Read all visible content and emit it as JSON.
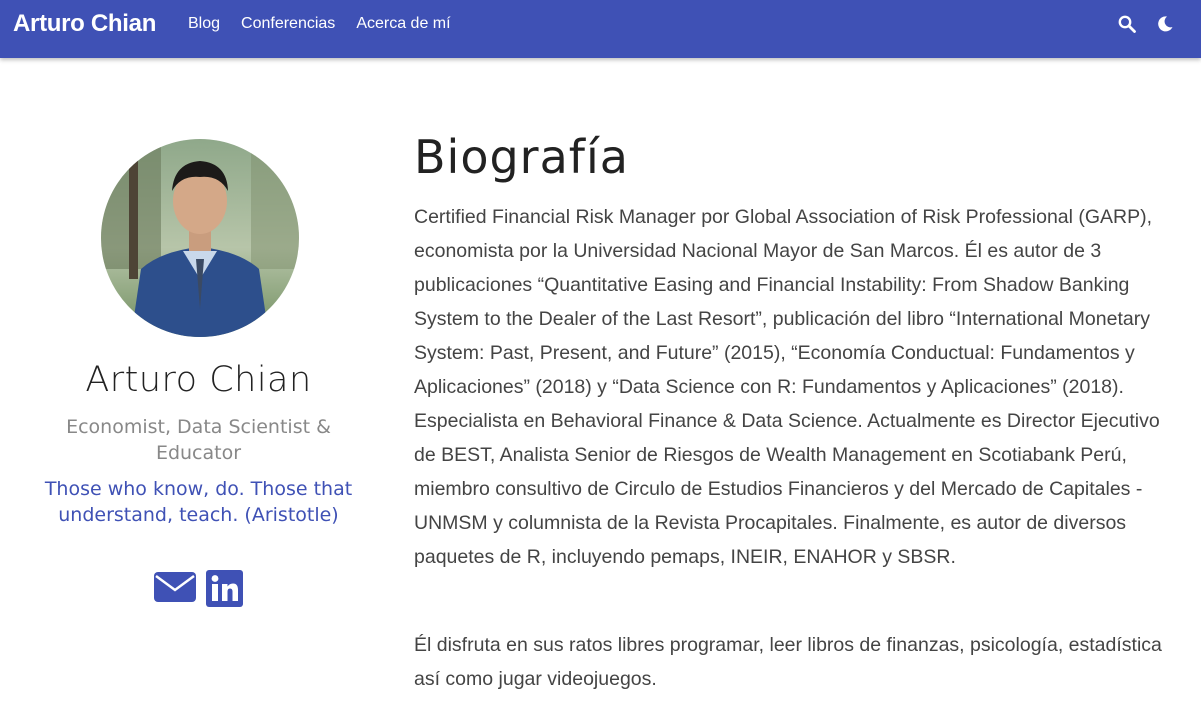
{
  "navbar": {
    "brand": "Arturo Chian",
    "links": [
      "Blog",
      "Conferencias",
      "Acerca de mí"
    ],
    "icons": [
      "search-icon",
      "moon-icon"
    ],
    "background": "#3f51b5"
  },
  "profile": {
    "name": "Arturo Chian",
    "role": "Economist, Data Scientist & Educator",
    "quote": "Those who know, do. Those that understand, teach. (Aristotle)",
    "social_icons": [
      "envelope-icon",
      "linkedin-icon"
    ],
    "accent": "#3f51b5"
  },
  "biography": {
    "title": "Biografía",
    "paragraph1": "Certified Financial Risk Manager por Global Association of Risk Professional (GARP), economista por la Universidad Nacional Mayor de San Marcos. Él es autor de 3 publicaciones “Quantitative Easing and Financial Instability: From Shadow Banking System to the Dealer of the Last Resort”, publicación del libro “International Monetary System: Past, Present, and Future” (2015), “Economía Conductual: Fundamentos y Aplicaciones” (2018) y “Data Science con R: Fundamentos y Aplicaciones” (2018). Especialista en Behavioral Finance & Data Science. Actualmente es Director Ejecutivo de BEST, Analista Senior de Riesgos de Wealth Management en Scotiabank Perú, miembro consultivo de Circulo de Estudios Financieros y del Mercado de Capitales - UNMSM y columnista de la Revista Procapitales. Finalmente, es autor de diversos paquetes de R, incluyendo pemaps, INEIR, ENAHOR y SBSR.",
    "paragraph2": "Él disfruta en sus ratos libres programar, leer libros de finanzas, psicología, estadística así como jugar videojuegos."
  }
}
